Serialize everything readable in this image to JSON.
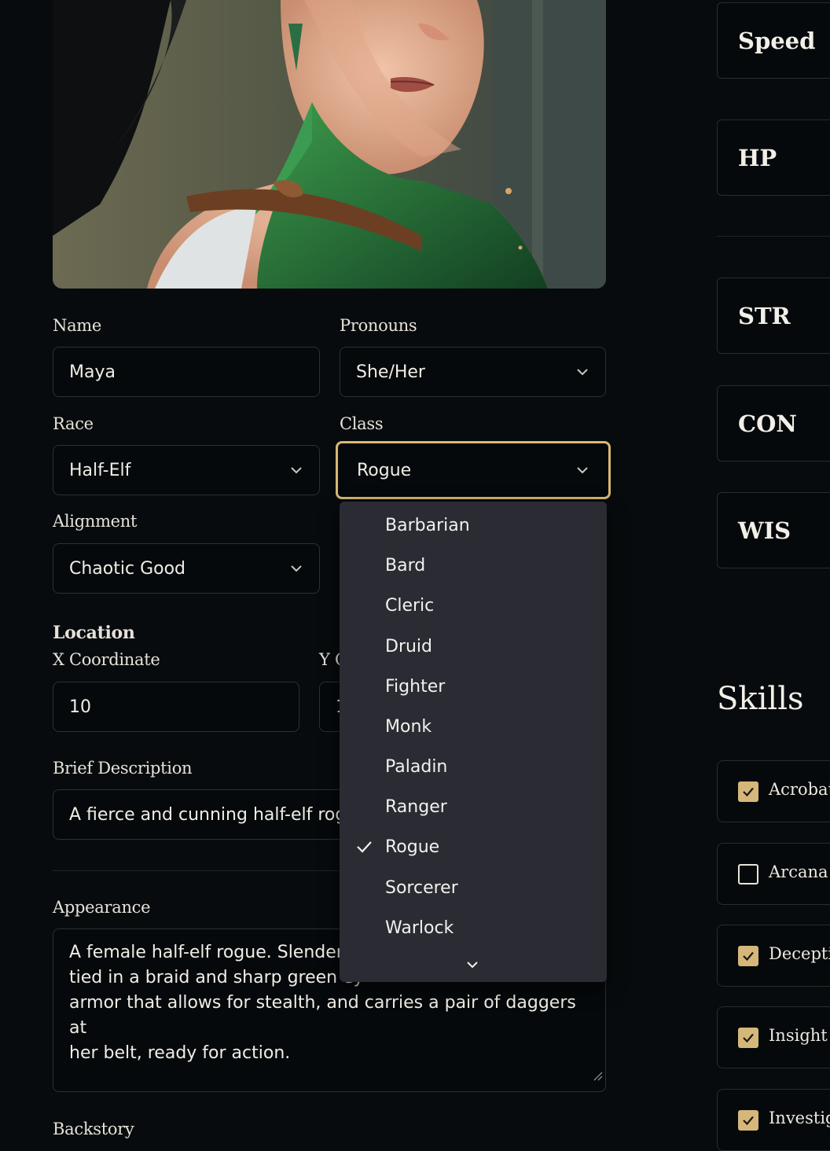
{
  "form": {
    "name": {
      "label": "Name",
      "value": "Maya"
    },
    "pronouns": {
      "label": "Pronouns",
      "value": "She/Her"
    },
    "race": {
      "label": "Race",
      "value": "Half-Elf"
    },
    "class": {
      "label": "Class",
      "value": "Rogue"
    },
    "alignment": {
      "label": "Alignment",
      "value": "Chaotic Good"
    },
    "location": {
      "heading": "Location",
      "x_label": "X Coordinate",
      "x_value": "10",
      "y_label_visible": "Y C",
      "y_value_visible": "1"
    },
    "brief": {
      "label": "Brief Description",
      "value_visible": "A fierce and cunning half-elf rog"
    },
    "appearance": {
      "label": "Appearance",
      "lines": [
        "A female half-elf rogue. Slender a",
        "tied in a braid and sharp green ey",
        "armor that allows for stealth, and carries a pair of daggers at",
        "her belt, ready for action."
      ]
    },
    "backstory": {
      "label": "Backstory"
    }
  },
  "class_dropdown": {
    "options": [
      "Barbarian",
      "Bard",
      "Cleric",
      "Druid",
      "Fighter",
      "Monk",
      "Paladin",
      "Ranger",
      "Rogue",
      "Sorcerer",
      "Warlock"
    ],
    "selected": "Rogue"
  },
  "stats": [
    "Speed",
    "HP",
    "STR",
    "CON",
    "WIS"
  ],
  "skills": {
    "title": "Skills",
    "items": [
      {
        "label": "Acrobati",
        "checked": true
      },
      {
        "label": "Arcana",
        "checked": false
      },
      {
        "label": "Deceptio",
        "checked": true
      },
      {
        "label": "Insight",
        "checked": true
      },
      {
        "label": "Investiga",
        "checked": true
      }
    ]
  },
  "colors": {
    "background": "#070b0d",
    "accent": "#d6b77a",
    "dropdown_bg": "#2a2b33"
  }
}
